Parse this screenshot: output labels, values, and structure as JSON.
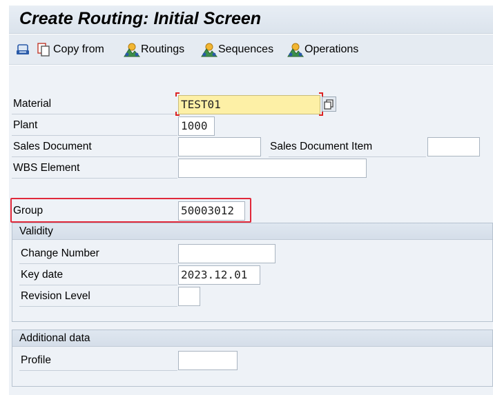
{
  "title": "Create Routing: Initial Screen",
  "toolbar": {
    "copy_from": "Copy from",
    "routings": "Routings",
    "sequences": "Sequences",
    "operations": "Operations"
  },
  "form": {
    "material_label": "Material",
    "material_value": "TEST01",
    "plant_label": "Plant",
    "plant_value": "1000",
    "sales_document_label": "Sales Document",
    "sales_document_value": "",
    "sales_document_item_label": "Sales Document Item",
    "sales_document_item_value": "",
    "wbs_element_label": "WBS Element",
    "wbs_element_value": "",
    "group_label": "Group",
    "group_value": "50003012"
  },
  "validity": {
    "title": "Validity",
    "change_number_label": "Change Number",
    "change_number_value": "",
    "key_date_label": "Key date",
    "key_date_value": "2023.12.01",
    "revision_level_label": "Revision Level",
    "revision_level_value": ""
  },
  "additional": {
    "title": "Additional data",
    "profile_label": "Profile",
    "profile_value": ""
  },
  "colors": {
    "required_field": "#fdf0a6",
    "highlight": "#e0283a",
    "background": "#eef2f7"
  }
}
